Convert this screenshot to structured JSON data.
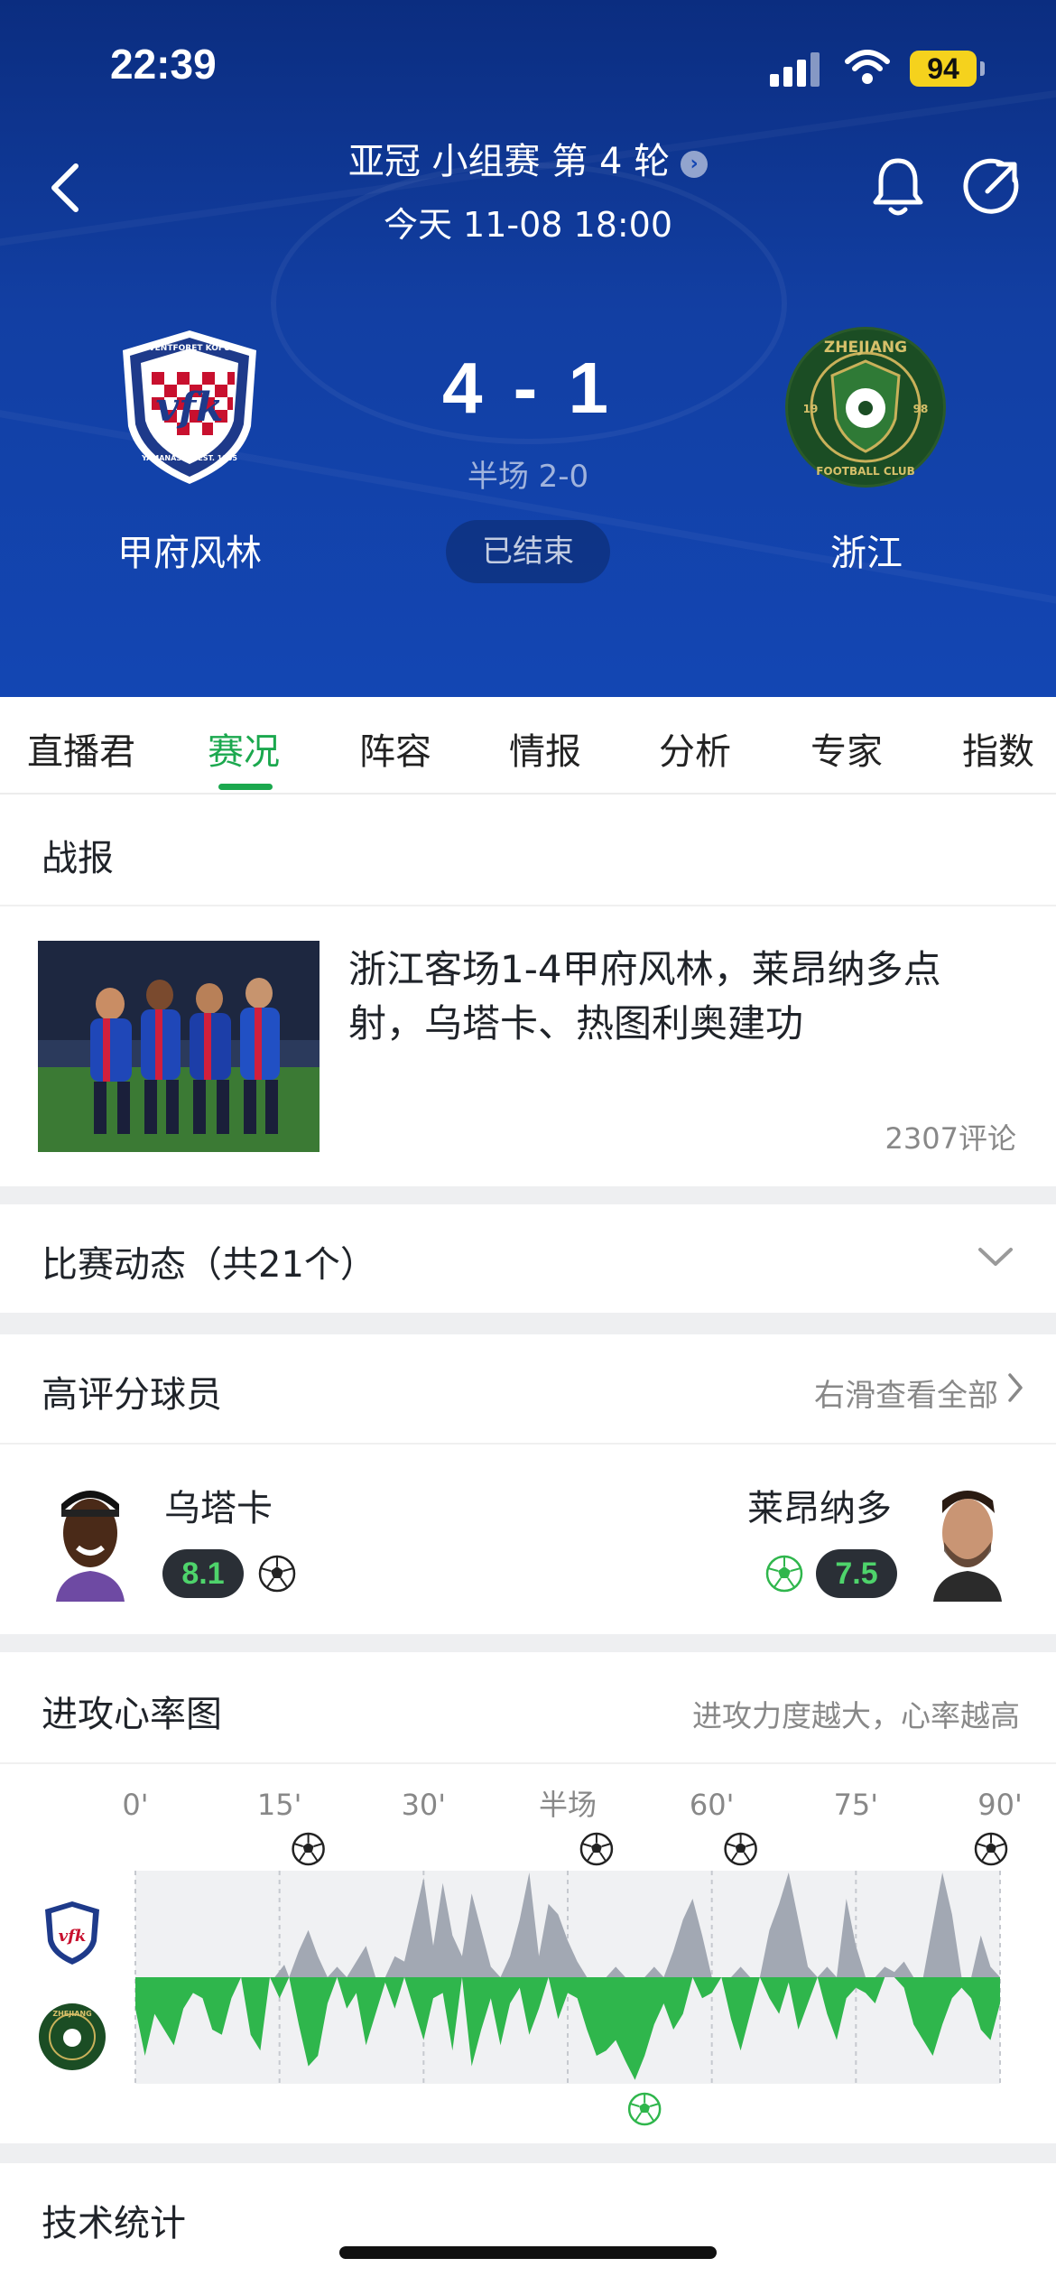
{
  "status_bar": {
    "time": "22:39",
    "battery": "94"
  },
  "match": {
    "competition": "亚冠 小组赛 第 4 轮",
    "kickoff": "今天 11-08 18:00",
    "home_team": "甲府风林",
    "away_team": "浙江",
    "score": "4 - 1",
    "halftime": "半场 2-0",
    "status": "已结束"
  },
  "tabs": [
    {
      "label": "直播君"
    },
    {
      "label": "赛况",
      "active": true
    },
    {
      "label": "阵容"
    },
    {
      "label": "情报"
    },
    {
      "label": "分析"
    },
    {
      "label": "专家"
    },
    {
      "label": "指数"
    }
  ],
  "report": {
    "header": "战报",
    "title": "浙江客场1-4甲府风林，莱昂纳多点射，乌塔卡、热图利奥建功",
    "comments": "2307评论"
  },
  "events": {
    "header": "比赛动态（共21个）"
  },
  "top_players": {
    "header": "高评分球员",
    "see_all": "右滑查看全部",
    "home_player": {
      "name": "乌塔卡",
      "rating": "8.1"
    },
    "away_player": {
      "name": "莱昂纳多",
      "rating": "7.5"
    }
  },
  "attack_chart": {
    "header": "进攻心率图",
    "note": "进攻力度越大，心率越高"
  },
  "chart_data": {
    "type": "area",
    "x_ticks": [
      "0'",
      "15'",
      "30'",
      "半场",
      "60'",
      "75'",
      "90'"
    ],
    "x_domain": [
      0,
      90
    ],
    "y_range": [
      -1,
      1
    ],
    "home_goal_minutes": [
      18,
      48,
      63,
      95
    ],
    "away_goal_minutes": [
      53
    ],
    "series": [
      {
        "team": "home",
        "color": "#a2a8b3",
        "x": [
          0,
          2,
          4,
          6,
          8,
          10,
          12,
          14,
          14.5,
          15.5,
          16,
          17,
          18,
          19,
          20,
          21,
          22,
          24,
          25,
          26,
          27,
          28,
          29,
          30,
          31,
          32,
          33,
          34,
          35,
          36,
          37,
          38,
          39,
          40,
          41,
          42,
          43,
          44,
          45,
          46,
          47,
          48,
          49,
          50,
          51,
          52,
          53,
          54,
          55,
          56,
          57,
          58,
          59,
          60,
          61,
          62,
          63,
          64,
          65,
          66,
          67,
          68,
          69,
          70,
          71,
          72,
          73,
          74,
          75,
          76,
          77,
          78,
          79,
          80,
          81,
          82,
          83,
          84,
          85,
          86,
          87,
          88,
          89,
          90
        ],
        "values": [
          0,
          0,
          0,
          0,
          0,
          0,
          0,
          0,
          0,
          0.12,
          0,
          0.25,
          0.45,
          0.2,
          0,
          0.1,
          0,
          0.3,
          0,
          0,
          0.2,
          0.15,
          0.55,
          0.95,
          0.3,
          0.9,
          0.4,
          0.2,
          0.8,
          0.45,
          0.1,
          0,
          0.2,
          0.55,
          1.0,
          0.2,
          0.7,
          0.6,
          0.35,
          0.15,
          0,
          0,
          0,
          0.1,
          0,
          0,
          0,
          0.1,
          0,
          0.25,
          0.55,
          0.75,
          0.4,
          0,
          0,
          0,
          0.1,
          0,
          0,
          0.45,
          0.7,
          1.0,
          0.55,
          0.1,
          0,
          0.1,
          0,
          0.75,
          0.3,
          0,
          0,
          0.1,
          0.05,
          0.15,
          0,
          0,
          0.5,
          1.0,
          0.6,
          0,
          0,
          0.4,
          0.1,
          0
        ]
      },
      {
        "team": "away",
        "color": "#2fb64c",
        "x": [
          0,
          1,
          2,
          3,
          4,
          5,
          6,
          7,
          8,
          9,
          10,
          11,
          12,
          13,
          14,
          15,
          16,
          17,
          18,
          19,
          20,
          21,
          22,
          23,
          24,
          25,
          26,
          27,
          28,
          29,
          30,
          31,
          32,
          33,
          34,
          35,
          36,
          37,
          38,
          39,
          40,
          41,
          42,
          43,
          44,
          45,
          46,
          47,
          48,
          49,
          50,
          51,
          52,
          53,
          54,
          55,
          56,
          57,
          58,
          59,
          60,
          61,
          62,
          63,
          64,
          65,
          66,
          67,
          68,
          69,
          70,
          71,
          72,
          73,
          74,
          75,
          76,
          77,
          78,
          79,
          80,
          81,
          82,
          83,
          84,
          85,
          86,
          87,
          88,
          89,
          90
        ],
        "values": [
          -0.3,
          -0.75,
          -0.35,
          -0.5,
          -0.65,
          -0.3,
          -0.15,
          -0.2,
          -0.5,
          -0.55,
          -0.2,
          0,
          -0.55,
          -0.7,
          0,
          -0.2,
          0,
          -0.45,
          -0.85,
          -0.75,
          -0.25,
          0,
          -0.3,
          -0.15,
          -0.65,
          -0.35,
          -0.05,
          -0.3,
          0,
          -0.3,
          -0.6,
          -0.2,
          -0.15,
          -0.7,
          0,
          -0.85,
          -0.5,
          -0.2,
          -0.65,
          -0.25,
          -0.1,
          -0.55,
          -0.3,
          0,
          -0.4,
          -0.15,
          -0.2,
          -0.5,
          -0.75,
          -0.7,
          -0.6,
          -0.8,
          -0.98,
          -0.75,
          -0.45,
          -0.25,
          -0.5,
          -0.35,
          0,
          -0.2,
          -0.15,
          0,
          -0.4,
          -0.7,
          -0.35,
          0,
          -0.2,
          -0.35,
          -0.05,
          -0.5,
          -0.25,
          0,
          -0.35,
          -0.6,
          -0.2,
          -0.1,
          -0.15,
          -0.25,
          0,
          0,
          -0.1,
          -0.45,
          -0.6,
          -0.75,
          -0.45,
          -0.2,
          -0.1,
          -0.2,
          -0.5,
          -0.6,
          -0.25
        ]
      }
    ]
  },
  "tech_stats": {
    "header": "技术统计"
  }
}
